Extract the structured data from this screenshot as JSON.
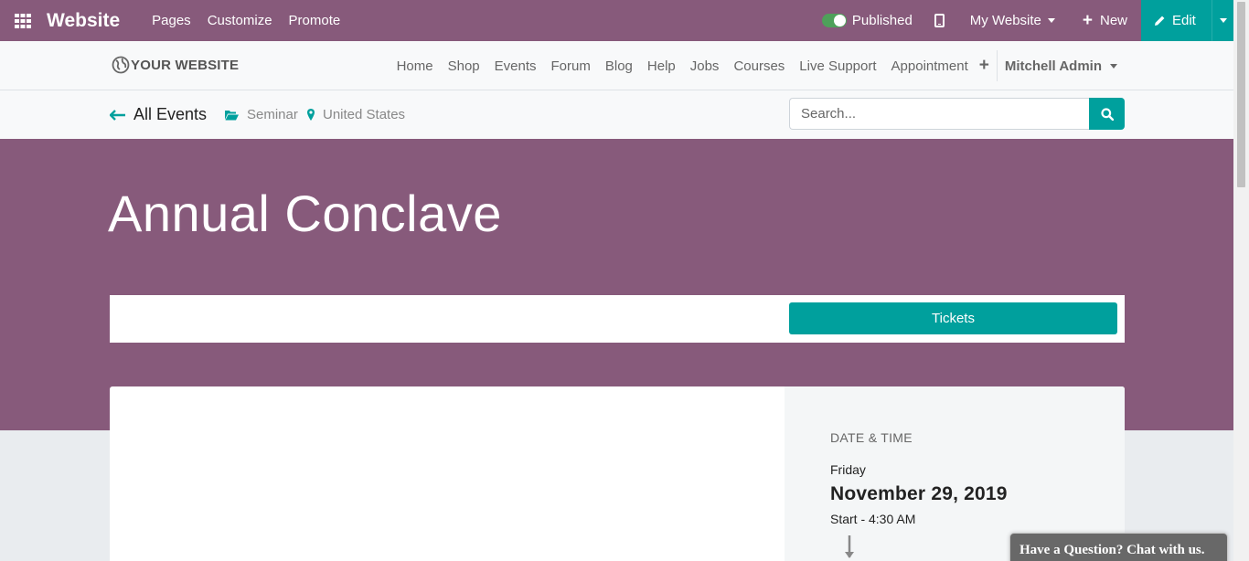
{
  "adminbar": {
    "brand": "Website",
    "menu": [
      "Pages",
      "Customize",
      "Promote"
    ],
    "published_label": "Published",
    "published_on": true,
    "website_switcher": "My Website",
    "new_label": "New",
    "edit_label": "Edit",
    "bg_color": "#875a7b",
    "accent_color": "#00a09d"
  },
  "site": {
    "logo_text": "YOUR WEBSITE",
    "nav": [
      "Home",
      "Shop",
      "Events",
      "Forum",
      "Blog",
      "Help",
      "Jobs",
      "Courses",
      "Live Support",
      "Appointment"
    ],
    "add_menu": "+",
    "user": "Mitchell Admin"
  },
  "events_bar": {
    "back_label": "All Events",
    "category": "Seminar",
    "location": "United States",
    "search_placeholder": "Search..."
  },
  "event": {
    "title": "Annual Conclave",
    "tickets_label": "Tickets",
    "date_time_label": "DATE & TIME",
    "day": "Friday",
    "date": "November 29, 2019",
    "start": "Start - 4:30 AM"
  },
  "chat": {
    "label": "Have a Question? Chat with us."
  }
}
